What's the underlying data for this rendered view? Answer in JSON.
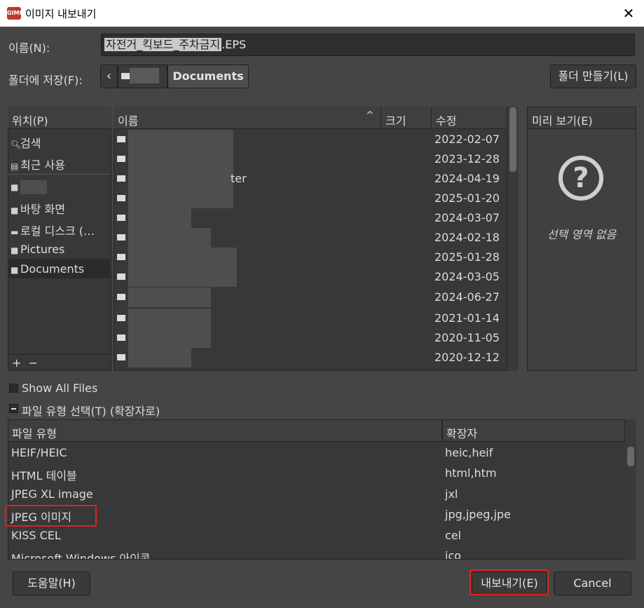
{
  "window": {
    "title": "이미지 내보내기",
    "close_glyph": "✕",
    "app_icon": "gimp-icon"
  },
  "name": {
    "label": "이름(N):",
    "selected_part": "자전거_킥보드_주차금지",
    "extension_part": ".EPS"
  },
  "folder": {
    "label": "폴더에 저장(F):",
    "back_glyph": "‹",
    "current": "Documents",
    "make_folder": "폴더 만들기(L)"
  },
  "places": {
    "header": "위치(P)",
    "items": [
      {
        "label": "검색",
        "icon": "search-icon"
      },
      {
        "label": "최근 사용",
        "icon": "recent-icon"
      },
      {
        "label": "",
        "icon": "folder-icon"
      },
      {
        "label": "바탕 화면",
        "icon": "folder-icon"
      },
      {
        "label": "로컬 디스크 (…",
        "icon": "drive-icon"
      },
      {
        "label": "Pictures",
        "icon": "folder-icon"
      },
      {
        "label": "Documents",
        "icon": "folder-icon"
      }
    ],
    "add_glyph": "+",
    "remove_glyph": "−"
  },
  "files": {
    "columns": {
      "name": "이름",
      "size": "크기",
      "modified": "수정"
    },
    "sort_glyph": "^",
    "rows": [
      {
        "name": "",
        "date": "2022-02-07"
      },
      {
        "name": "",
        "date": "2023-12-28"
      },
      {
        "name": "ter",
        "date": "2024-04-19"
      },
      {
        "name": "",
        "date": "2025-01-20"
      },
      {
        "name": "",
        "date": "2024-03-07"
      },
      {
        "name": "",
        "date": "2024-02-18"
      },
      {
        "name": "",
        "date": "2025-01-28"
      },
      {
        "name": "",
        "date": "2024-03-05"
      },
      {
        "name": "",
        "date": "2024-06-27"
      },
      {
        "name": "",
        "date": "2021-01-14"
      },
      {
        "name": "",
        "date": "2020-11-05"
      },
      {
        "name": "",
        "date": "2020-12-12"
      }
    ]
  },
  "preview": {
    "header": "미리 보기(E)",
    "icon_glyph": "?",
    "empty": "선택 영역 없음"
  },
  "show_all_files": {
    "label": "Show All Files",
    "checked": false
  },
  "file_type_toggle": {
    "label": "파일 유형 선택(T) (확장자로)"
  },
  "file_types": {
    "columns": {
      "type": "파일 유형",
      "extension": "확장자"
    },
    "rows": [
      {
        "type": "HEIF/HEIC",
        "ext": "heic,heif"
      },
      {
        "type": "HTML 테이블",
        "ext": "html,htm"
      },
      {
        "type": "JPEG XL image",
        "ext": "jxl"
      },
      {
        "type": "JPEG 이미지",
        "ext": "jpg,jpeg,jpe"
      },
      {
        "type": "KISS CEL",
        "ext": "cel"
      },
      {
        "type": "Microsoft Windows 아이콘",
        "ext": "ico"
      }
    ]
  },
  "buttons": {
    "help": "도움말(H)",
    "export": "내보내기(E)",
    "cancel": "Cancel"
  },
  "colors": {
    "highlight": "#e0201e",
    "background": "#454545"
  }
}
